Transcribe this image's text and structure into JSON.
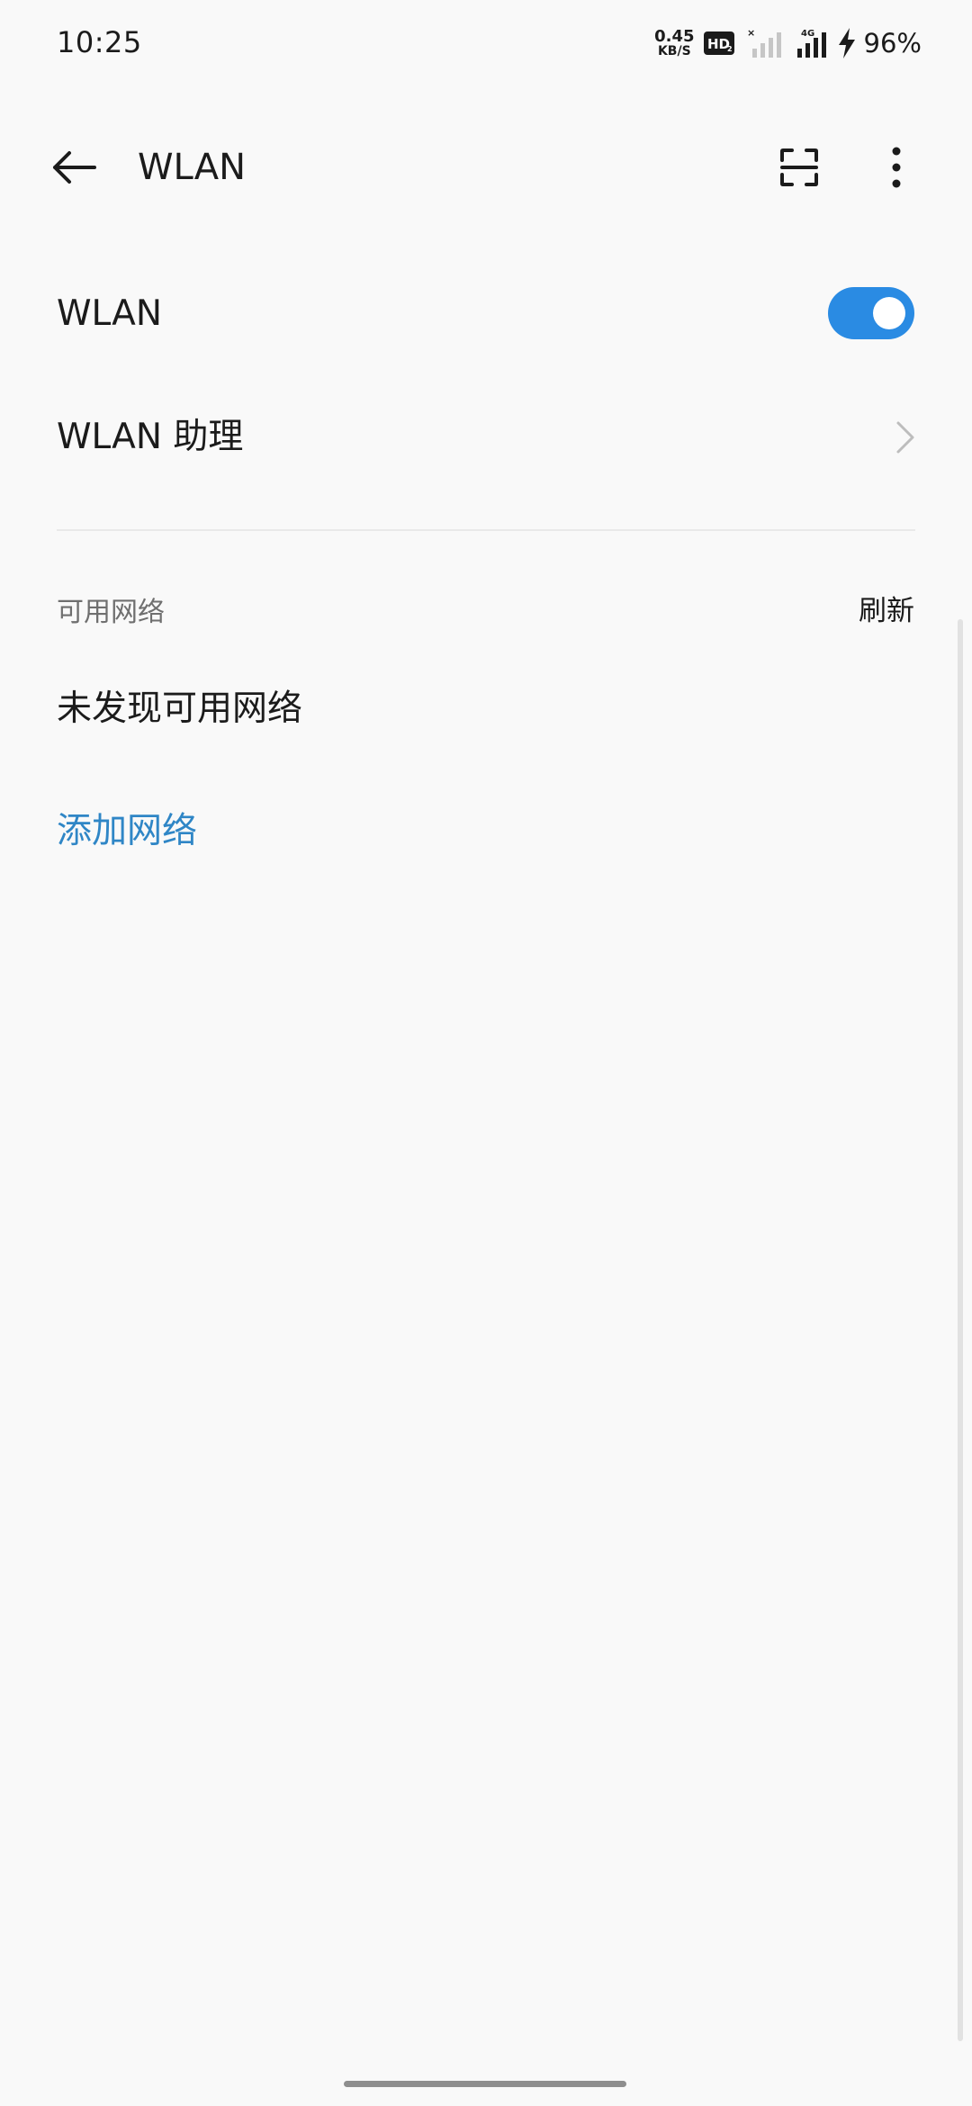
{
  "status_bar": {
    "time": "10:25",
    "net_speed_value": "0.45",
    "net_speed_unit": "KB/S",
    "hd_badge": "HD2",
    "sim1_icon": "no-signal-icon",
    "sim2_label": "4G",
    "battery_percent": "96%",
    "charging_icon": "bolt-icon"
  },
  "app_bar": {
    "title": "WLAN",
    "back_icon": "arrow-left-icon",
    "scan_icon": "scan-qr-icon",
    "more_icon": "more-vertical-icon"
  },
  "settings": {
    "wlan_label": "WLAN",
    "wlan_enabled": true,
    "assistant_label": "WLAN 助理"
  },
  "available_networks": {
    "section_title": "可用网络",
    "refresh_label": "刷新",
    "empty_message": "未发现可用网络",
    "add_network_label": "添加网络"
  },
  "colors": {
    "accent": "#2a8be3",
    "link": "#2f86c6",
    "background": "#f9f9f9",
    "text": "#1b1b1b",
    "secondary_text": "#6f6f6f"
  }
}
